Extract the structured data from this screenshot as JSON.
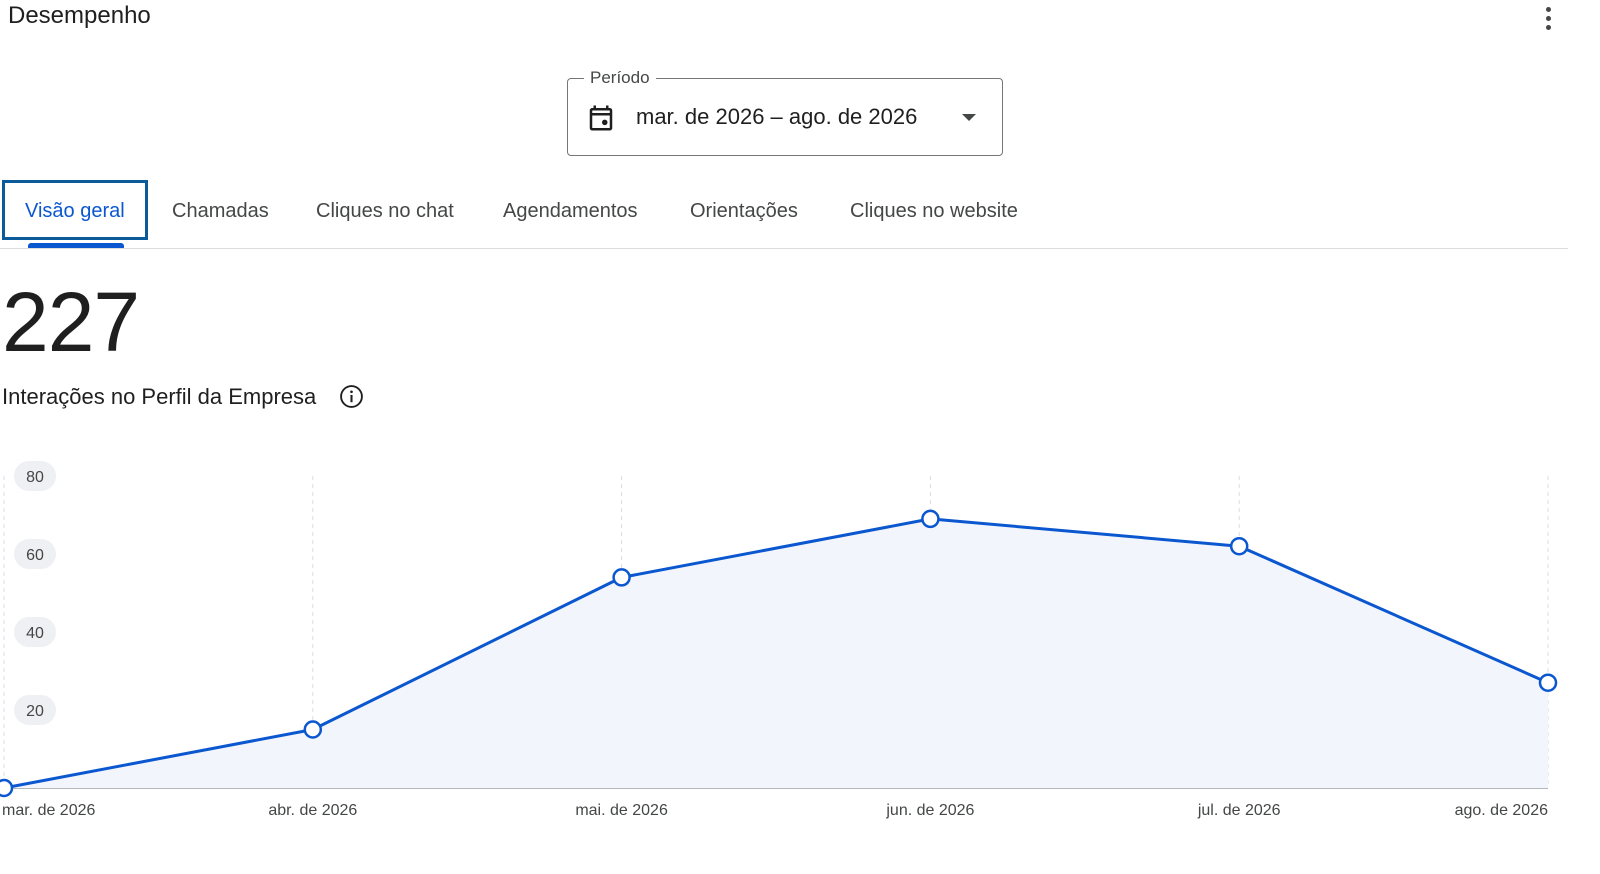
{
  "header": {
    "title": "Desempenho",
    "more_icon": "more-vert-icon"
  },
  "period": {
    "label": "Período",
    "value": "mar. de 2026 – ago. de 2026",
    "icon": "calendar-icon",
    "dropdown_icon": "arrow-drop-down-icon"
  },
  "tabs": [
    {
      "label": "Visão geral",
      "active": true
    },
    {
      "label": "Chamadas",
      "active": false
    },
    {
      "label": "Cliques no chat",
      "active": false
    },
    {
      "label": "Agendamentos",
      "active": false
    },
    {
      "label": "Orientações",
      "active": false
    },
    {
      "label": "Cliques no website",
      "active": false
    }
  ],
  "metric": {
    "value": "227",
    "label": "Interações no Perfil da Empresa",
    "info_icon": "info-icon"
  },
  "colors": {
    "accent": "#0b57d0",
    "area_fill": "#f2f6fc",
    "focus_ring": "#0b5a9a"
  },
  "chart_data": {
    "type": "area",
    "categories": [
      "mar. de 2026",
      "abr. de 2026",
      "mai. de 2026",
      "jun. de 2026",
      "jul. de 2026",
      "ago. de 2026"
    ],
    "series": [
      {
        "values": [
          0,
          15,
          54,
          69,
          62,
          27
        ]
      }
    ],
    "yticks": [
      20,
      40,
      60,
      80
    ],
    "ylim": [
      0,
      80
    ],
    "grid": "vertical-dashed",
    "markers": "hollow-circle"
  }
}
